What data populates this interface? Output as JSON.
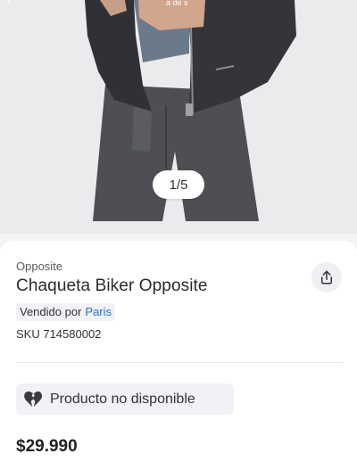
{
  "gallery": {
    "counter": "1/5",
    "back_icon": "chevron-left-icon"
  },
  "product": {
    "brand": "Opposite",
    "title": "Chaqueta Biker Opposite",
    "seller_prefix": "Vendido por",
    "seller_name": "Paris",
    "sku": "SKU 714580002",
    "availability": "Producto no disponible",
    "price": "$29.990"
  },
  "icons": {
    "share": "share-icon",
    "unavailable": "broken-heart-icon"
  },
  "colors": {
    "link": "#2c6fd6",
    "chip_bg": "#f1f2f6",
    "card_bg": "#ffffff"
  }
}
